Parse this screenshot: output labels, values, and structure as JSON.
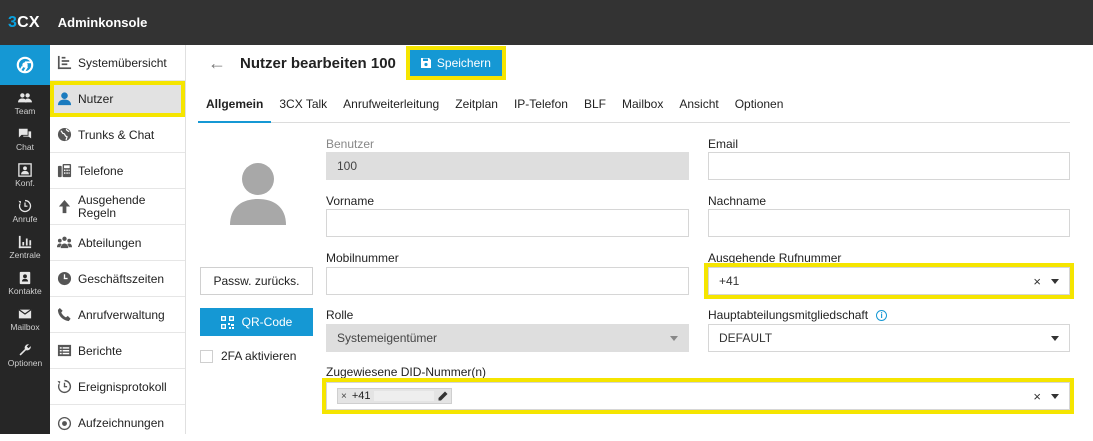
{
  "topbar": {
    "brand_prefix": "3",
    "brand_suffix": "CX",
    "title": "Adminkonsole"
  },
  "rail": {
    "items": [
      {
        "label": "Team",
        "icon": "team-icon"
      },
      {
        "label": "Chat",
        "icon": "chat-icon"
      },
      {
        "label": "Konf.",
        "icon": "conference-icon"
      },
      {
        "label": "Anrufe",
        "icon": "history-icon"
      },
      {
        "label": "Zentrale",
        "icon": "switchboard-icon"
      },
      {
        "label": "Kontakte",
        "icon": "contacts-icon"
      },
      {
        "label": "Mailbox",
        "icon": "mail-icon"
      },
      {
        "label": "Optionen",
        "icon": "wrench-icon"
      }
    ]
  },
  "sidebar": {
    "items": [
      {
        "label": "Systemübersicht",
        "icon": "dashboard-icon"
      },
      {
        "label": "Nutzer",
        "icon": "user-icon",
        "active": true
      },
      {
        "label": "Trunks & Chat",
        "icon": "globe-icon"
      },
      {
        "label": "Telefone",
        "icon": "phone-icon"
      },
      {
        "label": "Ausgehende Regeln",
        "icon": "arrow-up-icon"
      },
      {
        "label": "Abteilungen",
        "icon": "departments-icon"
      },
      {
        "label": "Geschäftszeiten",
        "icon": "clock-icon"
      },
      {
        "label": "Anrufverwaltung",
        "icon": "call-handling-icon"
      },
      {
        "label": "Berichte",
        "icon": "reports-icon"
      },
      {
        "label": "Ereignisprotokoll",
        "icon": "event-log-icon"
      },
      {
        "label": "Aufzeichnungen",
        "icon": "recordings-icon"
      }
    ]
  },
  "header": {
    "back": "←",
    "title": "Nutzer bearbeiten 100",
    "save_label": "Speichern"
  },
  "tabs": [
    "Allgemein",
    "3CX Talk",
    "Anrufweiterleitung",
    "Zeitplan",
    "IP-Telefon",
    "BLF",
    "Mailbox",
    "Ansicht",
    "Optionen"
  ],
  "left_panel": {
    "reset_password": "Passw. zurücks.",
    "qr_code": "QR-Code",
    "twofa": "2FA aktivieren"
  },
  "form": {
    "benutzer_label": "Benutzer",
    "benutzer_value": "100",
    "email_label": "Email",
    "vorname_label": "Vorname",
    "nachname_label": "Nachname",
    "mobil_label": "Mobilnummer",
    "ausgehend_label": "Ausgehende Rufnummer",
    "ausgehend_value": "+41",
    "rolle_label": "Rolle",
    "rolle_value": "Systemeigentümer",
    "haupt_label": "Hauptabteilungsmitgliedschaft",
    "haupt_value": "DEFAULT",
    "did_label": "Zugewiesene DID-Nummer(n)",
    "did_chip": "+41",
    "clear_symbol": "×"
  },
  "colors": {
    "accent": "#1598d4",
    "highlight": "#f5e500",
    "topbar": "#333333",
    "rail": "#262626"
  }
}
